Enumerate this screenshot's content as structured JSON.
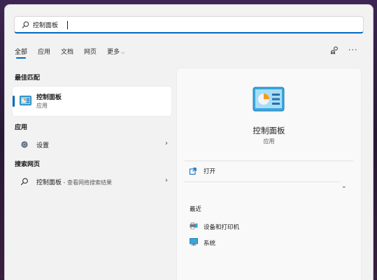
{
  "search": {
    "value": "控制面板",
    "placeholder": ""
  },
  "tabs": [
    {
      "label": "全部"
    },
    {
      "label": "应用"
    },
    {
      "label": "文档"
    },
    {
      "label": "网页"
    },
    {
      "label": "更多"
    }
  ],
  "sections": {
    "best_match": "最佳匹配",
    "apps": "应用",
    "web": "搜索网页"
  },
  "best_match": {
    "title": "控制面板",
    "subtitle": "应用"
  },
  "apps": [
    {
      "label": "设置"
    }
  ],
  "web": [
    {
      "label": "控制面板",
      "suffix": " - 查看网络搜索结果"
    }
  ],
  "preview": {
    "title": "控制面板",
    "kind": "应用",
    "action_open": "打开",
    "recent_title": "最近",
    "recent": [
      {
        "label": "设备和打印机"
      },
      {
        "label": "系统"
      }
    ]
  },
  "colors": {
    "accent": "#0067c0",
    "background": "#f2f2f2",
    "desktop": "#2b1a3d"
  },
  "icons": {
    "search": "search-icon",
    "control_panel": "control-panel-icon",
    "settings": "gear-icon",
    "open": "open-external-icon",
    "devices_printers": "devices-printers-icon",
    "system": "system-monitor-icon",
    "share": "share-icon",
    "more": "more-icon"
  }
}
